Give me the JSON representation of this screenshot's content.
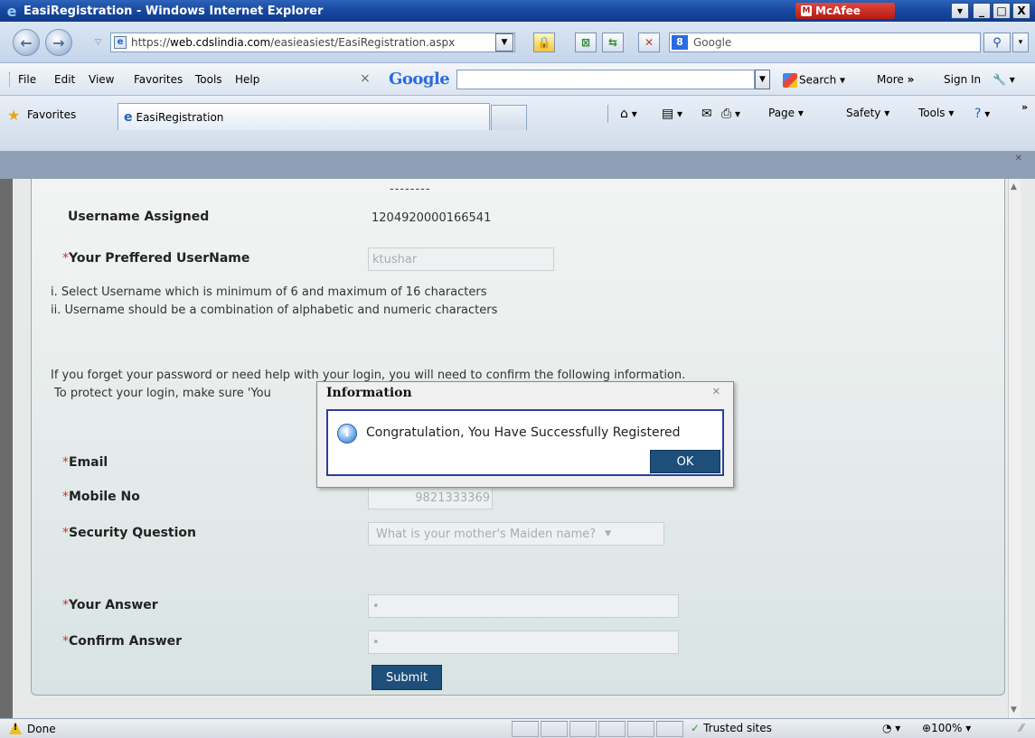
{
  "window": {
    "title": "EasiRegistration - Windows Internet Explorer",
    "mcafee": "McAfee",
    "min": "_",
    "max": "□",
    "close": "X"
  },
  "address": {
    "scheme": "https://",
    "host": "web.cdslindia.com",
    "path": "/easieasiest/EasiRegistration.aspx",
    "search_placeholder": "Google"
  },
  "menu": {
    "file": "File",
    "edit": "Edit",
    "view": "View",
    "favorites": "Favorites",
    "tools": "Tools",
    "help": "Help"
  },
  "google_toolbar": {
    "logo": "Google",
    "search": "Search",
    "more": "More",
    "signin": "Sign In"
  },
  "favbar": {
    "favorites": "Favorites",
    "tab_title": "EasiRegistration",
    "page": "Page",
    "safety": "Safety",
    "tools": "Tools"
  },
  "form": {
    "cut_number": "--------",
    "username_assigned_label": "Username Assigned",
    "username_assigned_value": "1204920000166541",
    "preferred_label": "Your Preffered UserName",
    "preferred_value": "ktushar",
    "rule_1": "i. Select Username which is minimum of 6 and maximum of 16 characters",
    "rule_2": "ii. Username should be a combination of alphabetic and numeric characters",
    "help_1": "If you forget your password or need help with your login, you will need to confirm the following information.",
    "help_2": "To protect your login, make sure 'You",
    "email_label": "Email",
    "mobile_label": "Mobile No",
    "mobile_value": "9821333369",
    "security_label": "Security Question",
    "security_value": "What is your mother's Maiden name?",
    "answer_label": "Your Answer",
    "answer_value": "•",
    "confirm_label": "Confirm Answer",
    "confirm_value": "•",
    "submit": "Submit"
  },
  "dialog": {
    "title": "Information",
    "message": "Congratulation, You Have Successfully Registered",
    "ok": "OK"
  },
  "status": {
    "text": "Done",
    "zone": "Trusted sites",
    "zoom": "100%"
  }
}
